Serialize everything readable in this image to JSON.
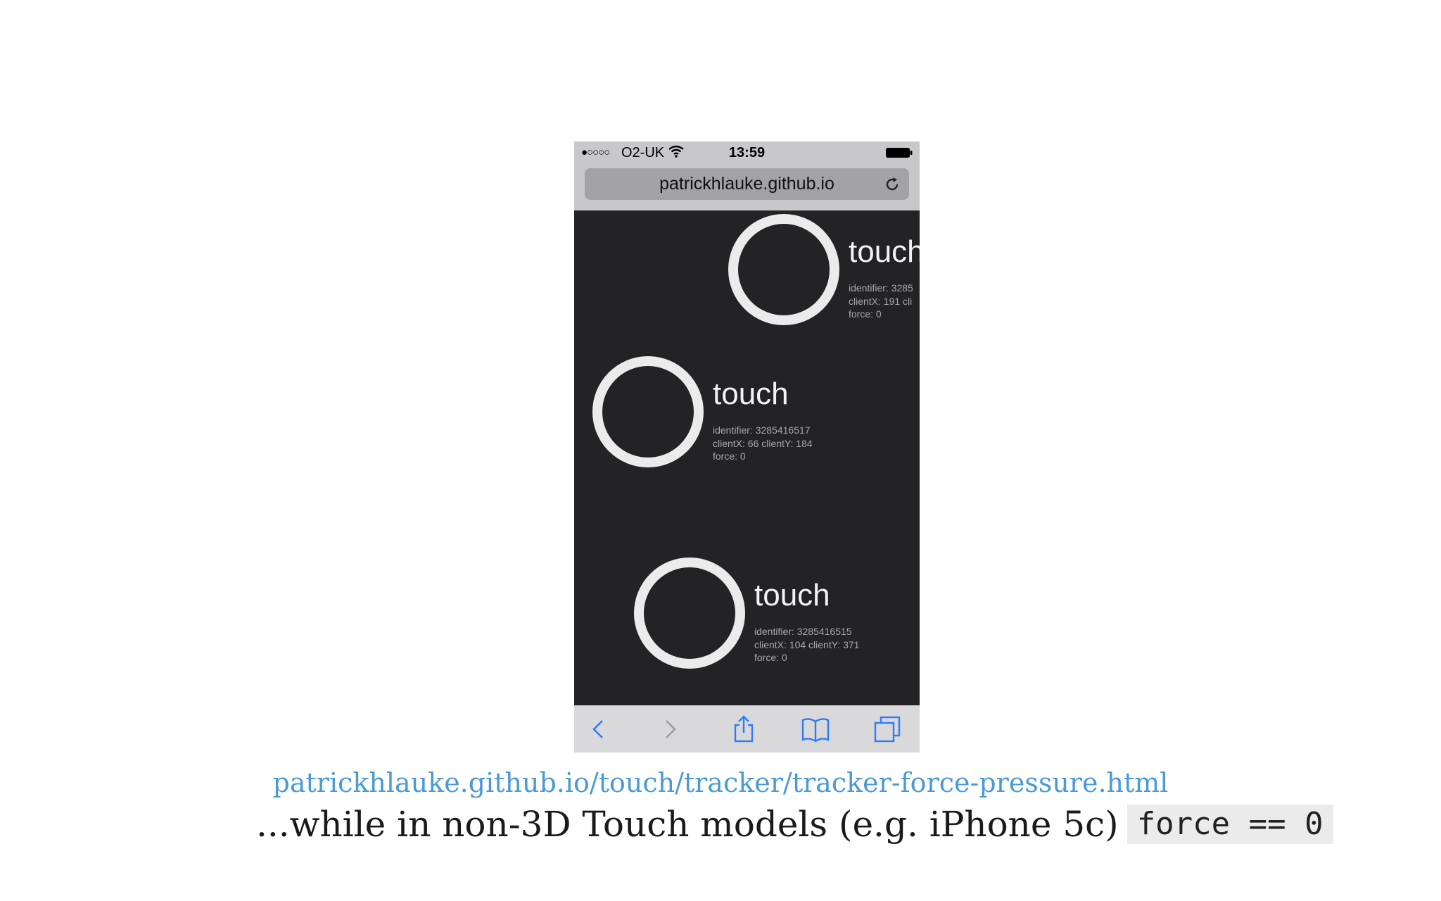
{
  "status_bar": {
    "signal": "●○○○○",
    "carrier": "O2-UK",
    "time": "13:59"
  },
  "browser": {
    "url": "patrickhlauke.github.io"
  },
  "touches": [
    {
      "label": "touch",
      "identifier": "identifier: 3285",
      "coords": "clientX: 191 cli",
      "force": "force: 0"
    },
    {
      "label": "touch",
      "identifier": "identifier: 3285416517",
      "coords": "clientX: 66 clientY: 184",
      "force": "force: 0"
    },
    {
      "label": "touch",
      "identifier": "identifier: 3285416515",
      "coords": "clientX: 104 clientY: 371",
      "force": "force: 0"
    }
  ],
  "caption": {
    "link": "patrickhlauke.github.io/touch/tracker/tracker-force-pressure.html",
    "text": "...while in non-3D Touch models (e.g. iPhone 5c)",
    "code": "force == 0"
  },
  "icons": [
    "wifi-icon",
    "battery-icon",
    "reload-icon",
    "back-icon",
    "forward-icon",
    "share-icon",
    "bookmarks-icon",
    "tabs-icon"
  ],
  "colors": {
    "page_background": "#232325",
    "ring": "#ebebeb",
    "link": "#4a9ad4",
    "toolbar_icon": "#2f7cf6"
  }
}
